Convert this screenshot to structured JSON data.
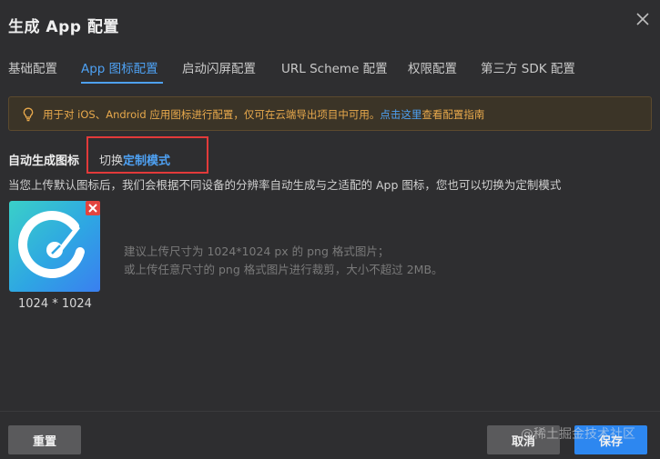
{
  "dialog": {
    "title": "生成 App 配置"
  },
  "tabs": [
    {
      "label": "基础配置",
      "active": false
    },
    {
      "label": "App 图标配置",
      "active": true
    },
    {
      "label": "启动闪屏配置",
      "active": false
    },
    {
      "label": "URL Scheme 配置",
      "active": false
    },
    {
      "label": "权限配置",
      "active": false
    },
    {
      "label": "第三方 SDK 配置",
      "active": false
    }
  ],
  "notice": {
    "text": "用于对 iOS、Android 应用图标进行配置，仅可在云端导出项目中可用。",
    "link": "点击这里",
    "tail": "查看配置指南"
  },
  "section": {
    "title": "自动生成图标",
    "switch_prefix": "切换",
    "switch_link": "定制模式",
    "description": "当您上传默认图标后，我们会根据不同设备的分辨率自动生成与之适配的 App 图标，您也可以切换为定制模式"
  },
  "icon": {
    "size_label": "1024 * 1024",
    "hint_line1": "建议上传尺寸为 1024*1024 px 的 png 格式图片；",
    "hint_line2": "或上传任意尺寸的 png 格式图片进行裁剪，大小不超过 2MB。"
  },
  "footer": {
    "reset": "重置",
    "cancel": "取消",
    "save": "保存",
    "watermark": "@稀土掘金技术社区"
  },
  "colors": {
    "accent": "#4ea1f3",
    "notice_text": "#e8a94c",
    "highlight_box": "#e23a3a",
    "save_button": "#2d87f0"
  }
}
